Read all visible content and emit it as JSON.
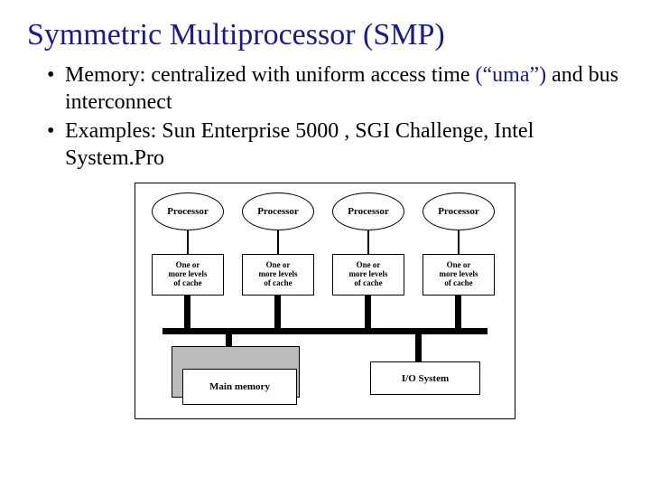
{
  "title": "Symmetric Multiprocessor (SMP)",
  "bullets": {
    "b1_prefix": "Memory: centralized with uniform access time ",
    "b1_uma": "(“uma”)",
    "b1_suffix": " and bus interconnect",
    "b2": "Examples: Sun Enterprise 5000 , SGI Challenge, Intel System.Pro"
  },
  "diagram": {
    "processor": "Processor",
    "cache": "One or\nmore levels\nof cache",
    "memory": "Main memory",
    "io": "I/O System"
  }
}
